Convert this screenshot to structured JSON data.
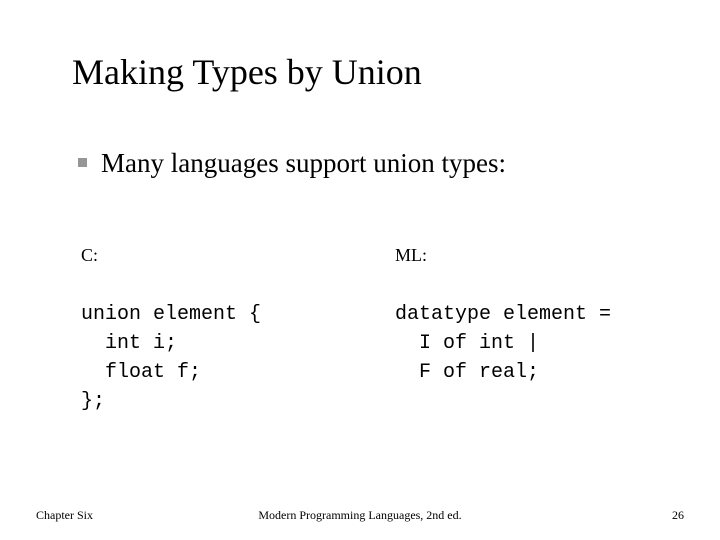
{
  "slide": {
    "title": "Making Types by Union",
    "bullet": {
      "marker": "square-bullet-icon",
      "text": "Many languages support union types:"
    },
    "columns": [
      {
        "label": "C:",
        "code": "union element {\n  int i;\n  float f;\n};"
      },
      {
        "label": "ML:",
        "code": "datatype element =\n  I of int |\n  F of real;"
      }
    ],
    "footer": {
      "left": "Chapter Six",
      "center": "Modern Programming Languages, 2nd ed.",
      "right": "26"
    },
    "colors": {
      "background": "#ffffff",
      "text": "#000000",
      "bullet_marker": "#969696"
    }
  }
}
